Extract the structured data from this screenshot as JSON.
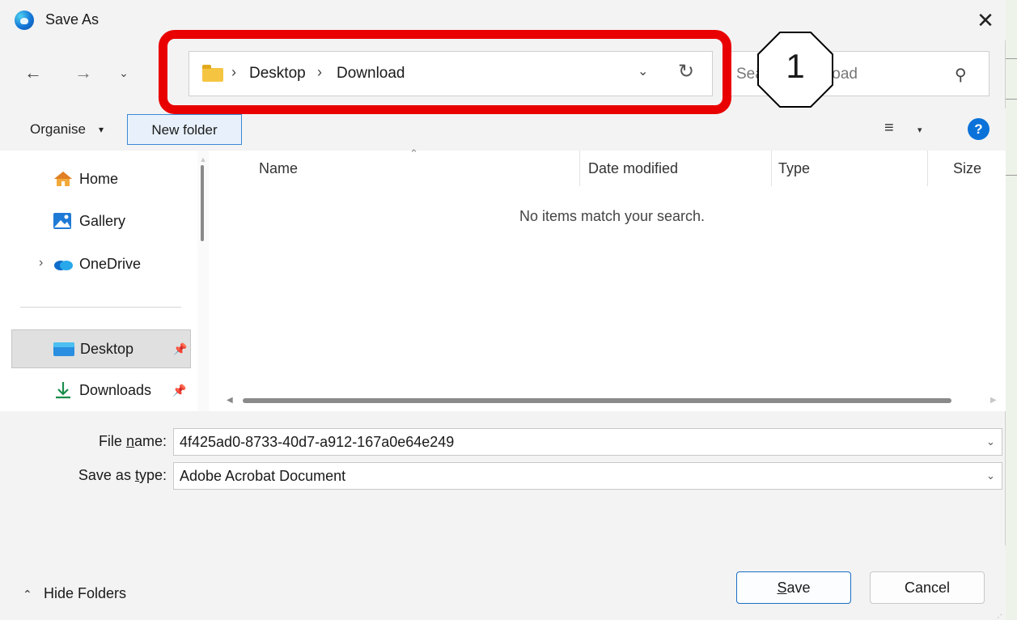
{
  "window": {
    "title": "Save As",
    "close_glyph": "✕"
  },
  "nav": {
    "back_glyph": "←",
    "forward_glyph": "→",
    "recent_glyph": "⌄",
    "up_glyph": "↑"
  },
  "address": {
    "breadcrumbs": [
      "Desktop",
      "Download"
    ],
    "separator": "›",
    "dropdown_glyph": "⌄",
    "refresh_glyph": "↻"
  },
  "search": {
    "placeholder": "Search Download",
    "search_glyph": "⚲"
  },
  "annotation": {
    "callout_number": "1",
    "highlight_color": "#e90000"
  },
  "toolbar": {
    "organise_label": "Organise",
    "organise_caret": "▾",
    "new_folder_label": "New folder",
    "view_glyph": "≡",
    "view_caret": "▾",
    "help_label": "?"
  },
  "sidebar": {
    "items": [
      {
        "label": "Home",
        "icon": "home-icon"
      },
      {
        "label": "Gallery",
        "icon": "gallery-icon"
      },
      {
        "label": "OneDrive",
        "icon": "onedrive-icon",
        "expand_glyph": "›"
      },
      {
        "label": "Desktop",
        "icon": "desktop-icon",
        "selected": true,
        "pin_glyph": "📌"
      },
      {
        "label": "Downloads",
        "icon": "downloads-icon",
        "pin_glyph": "📌"
      }
    ]
  },
  "filelist": {
    "columns": [
      "Name",
      "Date modified",
      "Type",
      "Size"
    ],
    "sort_glyph": "⌃",
    "empty_message": "No items match your search."
  },
  "form": {
    "file_name_label_pre": "File ",
    "file_name_label_u": "n",
    "file_name_label_post": "ame:",
    "file_name_value": "4f425ad0-8733-40d7-a912-167a0e64e249",
    "save_type_label_pre": "Save as ",
    "save_type_label_u": "t",
    "save_type_label_post": "ype:",
    "save_type_value": "Adobe Acrobat Document",
    "dropdown_glyph": "⌄"
  },
  "footer": {
    "hide_folders_glyph": "⌃",
    "hide_folders_label": "Hide Folders",
    "save_u": "S",
    "save_rest": "ave",
    "cancel_label": "Cancel"
  },
  "colors": {
    "accent": "#0a72d9",
    "selected_bg": "#e0e0e0",
    "folder": "#f5c542"
  }
}
